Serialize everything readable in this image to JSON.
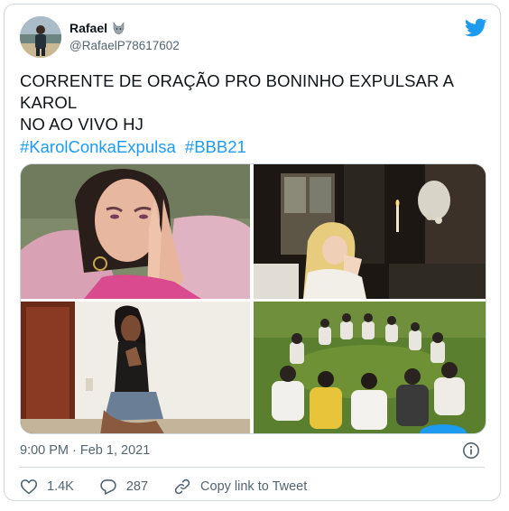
{
  "author": {
    "display_name": "Rafael",
    "handle": "@RafaelP78617602",
    "badge_icon": "wolf-icon"
  },
  "tweet": {
    "text_lines": [
      "CORRENTE DE ORAÇÃO PRO BONINHO EXPULSAR A KAROL",
      "NO AO VIVO HJ"
    ],
    "hashtags": [
      "#KarolConkaExpulsa",
      "#BBB21"
    ],
    "timestamp": "9:00 PM · Feb 1, 2021"
  },
  "media": [
    {
      "name": "photo-crying-woman-praying"
    },
    {
      "name": "photo-woman-praying-by-window"
    },
    {
      "name": "photo-woman-praying-kneeling"
    },
    {
      "name": "photo-prayer-circle-on-grass"
    }
  ],
  "actions": {
    "like_count": "1.4K",
    "reply_count": "287",
    "copy_link_label": "Copy link to Tweet"
  },
  "colors": {
    "accent": "#1d9bf0",
    "text": "#0f1419",
    "secondary": "#536471",
    "border": "#cfd9de"
  },
  "icons": [
    "twitter-bird-icon",
    "info-icon",
    "heart-icon",
    "reply-bubble-icon",
    "link-icon"
  ]
}
